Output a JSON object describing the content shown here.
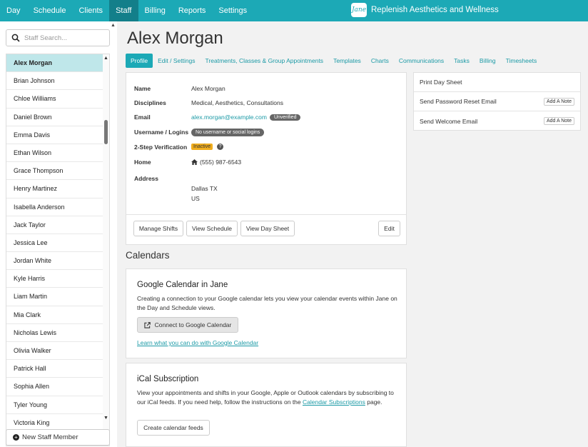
{
  "nav": {
    "items": [
      "Day",
      "Schedule",
      "Clients",
      "Staff",
      "Billing",
      "Reports",
      "Settings"
    ],
    "active": "Staff",
    "logo_text": "Jane",
    "brand_name": "Replenish Aesthetics and Wellness"
  },
  "sidebar": {
    "search_placeholder": "Staff Search...",
    "staff": [
      "Alex Morgan",
      "Brian Johnson",
      "Chloe Williams",
      "Daniel Brown",
      "Emma Davis",
      "Ethan Wilson",
      "Grace Thompson",
      "Henry Martinez",
      "Isabella Anderson",
      "Jack Taylor",
      "Jessica Lee",
      "Jordan White",
      "Kyle Harris",
      "Liam Martin",
      "Mia Clark",
      "Nicholas Lewis",
      "Olivia Walker",
      "Patrick Hall",
      "Sophia Allen",
      "Tyler Young",
      "Victoria King"
    ],
    "selected": "Alex Morgan",
    "new_staff_label": "New Staff Member"
  },
  "profile": {
    "name": "Alex Morgan",
    "tabs": [
      "Profile",
      "Edit / Settings",
      "Treatments, Classes & Group Appointments",
      "Templates",
      "Charts",
      "Communications",
      "Tasks",
      "Billing",
      "Timesheets"
    ],
    "active_tab": "Profile",
    "fields": {
      "name_label": "Name",
      "name_value": "Alex Morgan",
      "disciplines_label": "Disciplines",
      "disciplines_value": "Medical, Aesthetics, Consultations",
      "email_label": "Email",
      "email_value": "alex.morgan@example.com",
      "email_badge": "Unverified",
      "username_label": "Username / Logins",
      "username_badge": "No username or social logins",
      "twostep_label": "2-Step Verification",
      "twostep_badge": "Inactive",
      "home_label": "Home",
      "home_value": "(555) 987-6543",
      "address_label": "Address",
      "address_line1": "Dallas TX",
      "address_line2": "US"
    },
    "buttons": {
      "manage_shifts": "Manage Shifts",
      "view_schedule": "View Schedule",
      "view_day_sheet": "View Day Sheet",
      "edit": "Edit"
    }
  },
  "actions": {
    "print_day_sheet": "Print Day Sheet",
    "send_password_reset": "Send Password Reset Email",
    "send_welcome": "Send Welcome Email",
    "add_note": "Add A Note"
  },
  "calendars": {
    "heading": "Calendars",
    "google": {
      "title": "Google Calendar in Jane",
      "description": "Creating a connection to your Google calendar lets you view your calendar events within Jane on the Day and Schedule views.",
      "button": "Connect to Google Calendar",
      "link": "Learn what you can do with Google Calendar"
    },
    "ical": {
      "title": "iCal Subscription",
      "description_start": "View your appointments and shifts in your Google, Apple or Outlook calendars by subscribing to our iCal feeds. If you need help, follow the instructions on the ",
      "description_link": "Calendar Subscriptions",
      "description_end": " page.",
      "button": "Create calendar feeds"
    }
  },
  "colors": {
    "brand": "#1ca9b6",
    "nav_active": "#137f8a",
    "selected_row": "#bfe7ea",
    "badge_inactive": "#f0ad1e"
  }
}
